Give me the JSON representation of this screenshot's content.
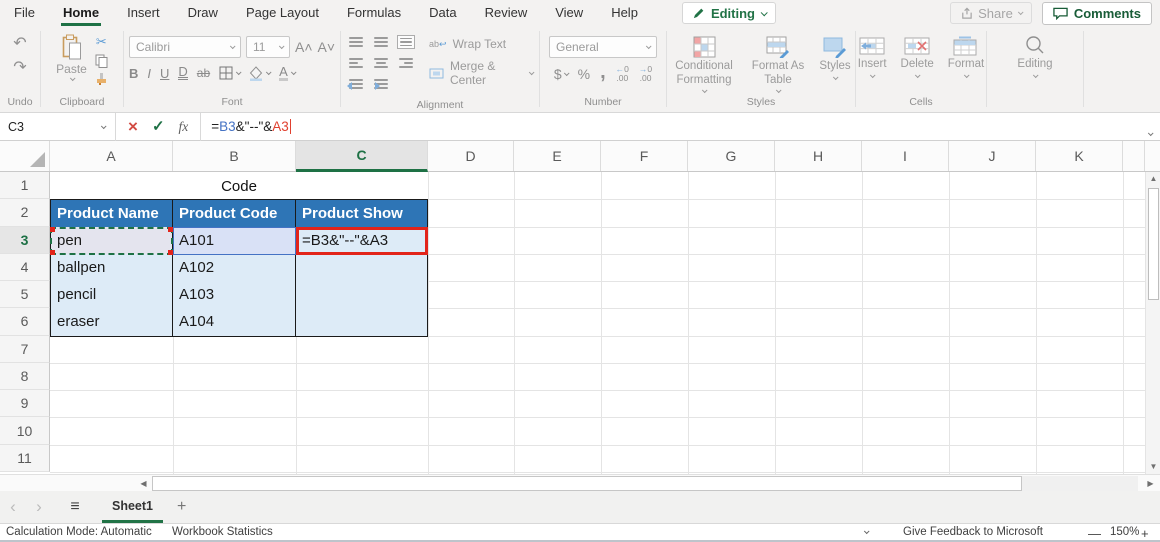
{
  "tabs": [
    "File",
    "Home",
    "Insert",
    "Draw",
    "Page Layout",
    "Formulas",
    "Data",
    "Review",
    "View",
    "Help"
  ],
  "active_tab": "Home",
  "top_bar": {
    "editing_label": "Editing",
    "share_label": "Share",
    "comments_label": "Comments"
  },
  "ribbon": {
    "undo": {
      "label": "Undo"
    },
    "clipboard": {
      "label": "Clipboard",
      "paste": "Paste"
    },
    "font": {
      "label": "Font",
      "font_name": "Calibri",
      "font_size": "11",
      "bold": "B",
      "italic": "I",
      "underline": "U",
      "double_underline": "D",
      "strikethrough": "ab"
    },
    "alignment": {
      "label": "Alignment",
      "wrap_text": "Wrap Text",
      "merge_center": "Merge & Center",
      "wrap_icon_text": "ab"
    },
    "number": {
      "label": "Number",
      "format": "General",
      "currency": "$",
      "percent": "%",
      "comma": ",",
      "increase_decimal": "←.0",
      "decrease_decimal": ".00"
    },
    "styles": {
      "label": "Styles",
      "conditional_formatting": "Conditional Formatting",
      "format_as_table": "Format As Table",
      "cell_styles": "Styles"
    },
    "cells": {
      "label": "Cells",
      "insert": "Insert",
      "delete": "Delete",
      "format": "Format"
    },
    "editing_group": {
      "label": "Editing"
    }
  },
  "formula_bar": {
    "name_box": "C3",
    "fx": "fx",
    "cancel": "×",
    "enter": "✓",
    "formula_eq": "=",
    "formula_ref1": "B3",
    "formula_mid": "&\"--\"&",
    "formula_ref2": "A3"
  },
  "grid": {
    "columns": [
      "A",
      "B",
      "C",
      "D",
      "E",
      "F",
      "G",
      "H",
      "I",
      "J",
      "K"
    ],
    "active_column": "C",
    "row_numbers": [
      "1",
      "2",
      "3",
      "4",
      "5",
      "6",
      "7",
      "8",
      "9",
      "10",
      "11"
    ],
    "active_row": "3"
  },
  "sheet": {
    "title": "Code",
    "headers": [
      "Product Name",
      "Product Code",
      "Product Show"
    ],
    "rows": [
      [
        "pen",
        "A101",
        "=B3&\"--\"&A3"
      ],
      [
        "ballpen",
        "A102",
        ""
      ],
      [
        "pencil",
        "A103",
        ""
      ],
      [
        "eraser",
        "A104",
        ""
      ]
    ]
  },
  "sheet_bar": {
    "sheet_name": "Sheet1",
    "prev_glyph": "‹",
    "next_glyph": "›",
    "menu_glyph": "≡",
    "add_glyph": "+"
  },
  "status_bar": {
    "calculation_mode": "Calculation Mode: Automatic",
    "workbook_statistics": "Workbook Statistics",
    "feedback": "Give Feedback to Microsoft",
    "zoom": "150%",
    "zoom_out": "—",
    "zoom_in": "+"
  },
  "glyphs": {
    "undo": "↶",
    "redo": "↷",
    "cut": "✂",
    "up": "▲",
    "down": "▼",
    "left": "◀",
    "right": "▶",
    "wrap_return": "↩"
  },
  "colors": {
    "accent_green": "#217346",
    "header_blue": "#2E75B6",
    "body_fill": "#DDEBF7",
    "annotation_red": "#E2241A",
    "ref_blue": "#4472C4",
    "ref_red": "#E0402F"
  }
}
